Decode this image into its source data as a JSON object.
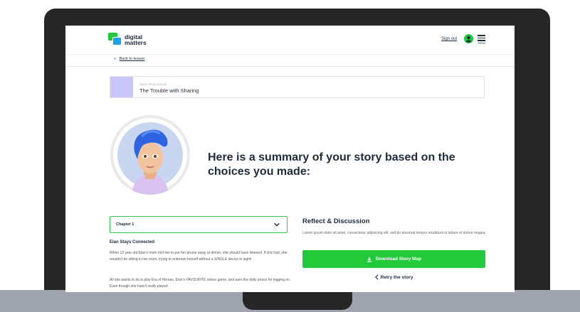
{
  "header": {
    "logo_line1": "digital",
    "logo_line2": "matters",
    "signout_label": "Sign out",
    "menu_label": "MENU"
  },
  "nav": {
    "back_arrow": "«",
    "back_label": "Back to lesson"
  },
  "story": {
    "subtitle": "ONCE UPON ONLINE",
    "title": "The Trouble with Sharing"
  },
  "summary": {
    "heading": "Here is a summary of your story based on the choices you made:"
  },
  "chapter": {
    "selected": "Chapter 1",
    "title": "Elan Stays Connected",
    "paragraph1": "When 13 year old Elan's mum told her to put her phone away at dinner, she should have listened. If she had, she wouldn't be sitting in her room, trying to entertain herself without a SINGLE device in sight!",
    "paragraph2": "All she wants to do is play Era of Heroes, Elan's FAVOURITE online game, and earn the daily prizes for logging on. Even though she hasn't really played"
  },
  "reflect": {
    "heading": "Reflect & Discussion",
    "text": "Lorem ipsum dolor sit amet, consectetur adipiscing elit, sed do eiusmod tempor incididunt ut labore et dolore magna.",
    "download_label": "Download Story Map",
    "retry_label": "Retry the story"
  },
  "colors": {
    "brand_green": "#22c93a",
    "brand_blue": "#1aa3e8",
    "text_dark": "#1e2b3a",
    "story_thumb": "#c9c6fb"
  },
  "icons": [
    "logo-icon",
    "user-circle-icon",
    "hamburger-menu-icon",
    "chevron-down-icon",
    "download-icon",
    "chevron-left-icon"
  ]
}
